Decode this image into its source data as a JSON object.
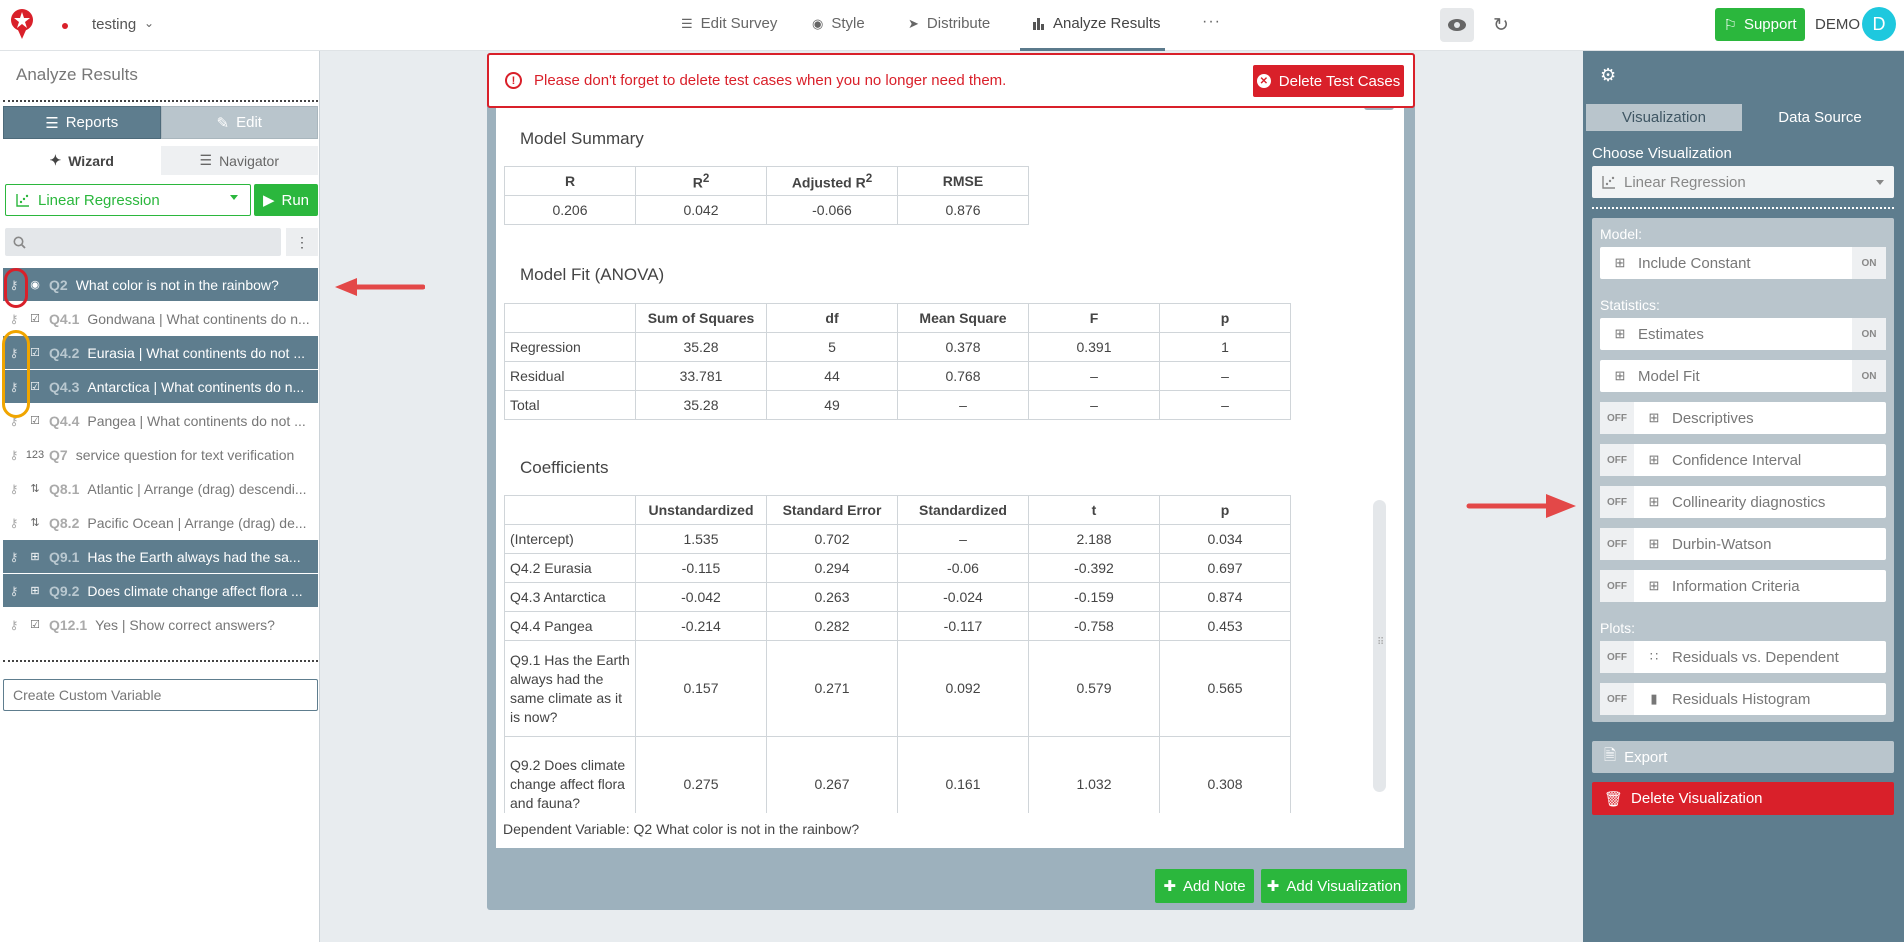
{
  "header": {
    "project_name": "testing",
    "nav": [
      {
        "label": "Edit Survey"
      },
      {
        "label": "Style"
      },
      {
        "label": "Distribute"
      },
      {
        "label": "Analyze Results"
      },
      {
        "label": "···"
      }
    ],
    "support_label": "Support",
    "user_label": "DEMO",
    "avatar_letter": "D"
  },
  "left_panel": {
    "title": "Analyze Results",
    "tabs": {
      "reports": "Reports",
      "edit": "Edit"
    },
    "subtabs": {
      "wizard": "Wizard",
      "navigator": "Navigator"
    },
    "viz_select": "Linear Regression",
    "run_label": "Run",
    "search_placeholder": "",
    "questions": [
      {
        "num": "Q2",
        "text": "What color is not in the rainbow?",
        "selected": true,
        "icon": "radio-icon"
      },
      {
        "num": "Q4.1",
        "text": "Gondwana | What continents do n...",
        "selected": false,
        "icon": "checkbox-icon"
      },
      {
        "num": "Q4.2",
        "text": "Eurasia | What continents do not ...",
        "selected": true,
        "icon": "checkbox-icon"
      },
      {
        "num": "Q4.3",
        "text": "Antarctica | What continents do n...",
        "selected": true,
        "icon": "checkbox-icon"
      },
      {
        "num": "Q4.4",
        "text": "Pangea | What continents do not ...",
        "selected": false,
        "icon": "checkbox-icon"
      },
      {
        "num": "Q7",
        "text": "service question for text verification",
        "selected": false,
        "icon": "numeric-icon"
      },
      {
        "num": "Q8.1",
        "text": "Atlantic | Arrange (drag) descendi...",
        "selected": false,
        "icon": "sort-icon"
      },
      {
        "num": "Q8.2",
        "text": "Pacific Ocean | Arrange (drag) de...",
        "selected": false,
        "icon": "sort-icon"
      },
      {
        "num": "Q9.1",
        "text": "Has the Earth always had the sa...",
        "selected": true,
        "icon": "grid-icon"
      },
      {
        "num": "Q9.2",
        "text": "Does climate change affect flora ...",
        "selected": true,
        "icon": "grid-icon"
      },
      {
        "num": "Q12.1",
        "text": "Yes | Show correct answers?",
        "selected": false,
        "icon": "checkbox-icon"
      }
    ],
    "custom_variable_placeholder": "Create Custom Variable"
  },
  "warning": {
    "text": "Please don't forget to delete test cases when you no longer need them.",
    "button": "Delete Test Cases"
  },
  "model_summary": {
    "title": "Model Summary",
    "headers": [
      "R",
      "R",
      "Adjusted R",
      "RMSE"
    ],
    "sup": "2",
    "row": [
      "0.206",
      "0.042",
      "-0.066",
      "0.876"
    ]
  },
  "anova": {
    "title": "Model Fit (ANOVA)",
    "headers": [
      "",
      "Sum of Squares",
      "df",
      "Mean Square",
      "F",
      "p"
    ],
    "rows": [
      [
        "Regression",
        "35.28",
        "5",
        "0.378",
        "0.391",
        "1"
      ],
      [
        "Residual",
        "33.781",
        "44",
        "0.768",
        "–",
        "–"
      ],
      [
        "Total",
        "35.28",
        "49",
        "–",
        "–",
        "–"
      ]
    ]
  },
  "coefficients": {
    "title": "Coefficients",
    "headers": [
      "",
      "Unstandardized",
      "Standard Error",
      "Standardized",
      "t",
      "p"
    ],
    "rows": [
      [
        "(Intercept)",
        "1.535",
        "0.702",
        "–",
        "2.188",
        "0.034"
      ],
      [
        "Q4.2 Eurasia",
        "-0.115",
        "0.294",
        "-0.06",
        "-0.392",
        "0.697"
      ],
      [
        "Q4.3 Antarctica",
        "-0.042",
        "0.263",
        "-0.024",
        "-0.159",
        "0.874"
      ],
      [
        "Q4.4 Pangea",
        "-0.214",
        "0.282",
        "-0.117",
        "-0.758",
        "0.453"
      ],
      [
        "Q9.1 Has the Earth always had the same climate as it is now?",
        "0.157",
        "0.271",
        "0.092",
        "0.579",
        "0.565"
      ],
      [
        "Q9.2 Does climate change affect flora and fauna?",
        "0.275",
        "0.267",
        "0.161",
        "1.032",
        "0.308"
      ]
    ]
  },
  "dependent_variable": "Dependent Variable: Q2 What color is not in the rainbow?",
  "center_buttons": {
    "add_note": "Add Note",
    "add_visualization": "Add Visualization"
  },
  "right_panel": {
    "tabs": {
      "visualization": "Visualization",
      "data_source": "Data Source"
    },
    "choose_label": "Choose Visualization",
    "viz_select": "Linear Regression",
    "groups": {
      "model": "Model:",
      "statistics": "Statistics:",
      "plots": "Plots:"
    },
    "on_label": "ON",
    "off_label": "OFF",
    "options": {
      "include_constant": "Include Constant",
      "estimates": "Estimates",
      "model_fit": "Model Fit",
      "descriptives": "Descriptives",
      "confidence_interval": "Confidence Interval",
      "collinearity": "Collinearity diagnostics",
      "durbin_watson": "Durbin-Watson",
      "information_criteria": "Information Criteria",
      "residuals_vs_dependent": "Residuals vs. Dependent",
      "residuals_histogram": "Residuals Histogram"
    },
    "export_label": "Export",
    "delete_label": "Delete Visualization"
  },
  "colors": {
    "accent_green": "#2bb73d",
    "slate": "#5e7d8e",
    "danger": "#d9202a",
    "annotation_orange": "#f0a500"
  }
}
